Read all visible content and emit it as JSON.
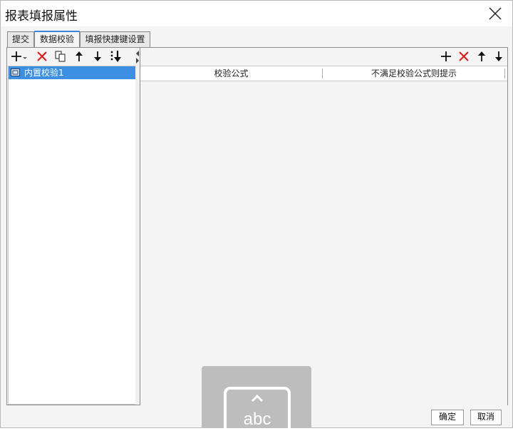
{
  "window": {
    "title": "报表填报属性"
  },
  "tabs": [
    {
      "label": "提交",
      "active": false
    },
    {
      "label": "数据校验",
      "active": true
    },
    {
      "label": "填报快捷键设置",
      "active": false
    }
  ],
  "left_toolbar": {
    "icons": [
      "add-icon",
      "dropdown-icon",
      "delete-icon",
      "copy-icon",
      "move-up-icon",
      "move-down-icon",
      "move-bottom-icon"
    ]
  },
  "validation_list": {
    "items": [
      {
        "label": "内置校验1",
        "selected": true
      }
    ]
  },
  "right_toolbar": {
    "icons": [
      "add-icon",
      "delete-icon",
      "move-up-icon",
      "move-down-icon"
    ]
  },
  "grid": {
    "columns": [
      "校验公式",
      "不满足校验公式则提示"
    ],
    "rows": []
  },
  "footer": {
    "confirm_label": "确定",
    "cancel_label": "取消"
  },
  "ime": {
    "text": "abc"
  },
  "colors": {
    "accent": "#3c8fe3",
    "delete": "#e02020",
    "tab_highlight": "#3b84d6"
  }
}
